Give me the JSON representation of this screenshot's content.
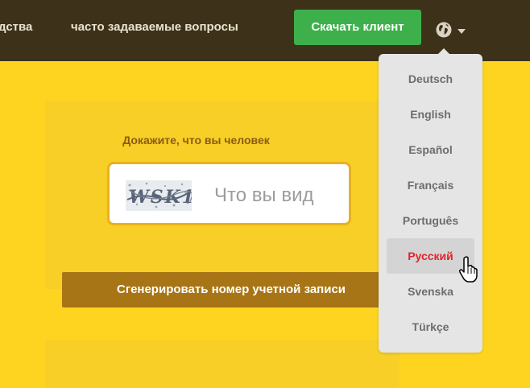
{
  "nav": {
    "links": [
      {
        "label": "дства"
      },
      {
        "label": "часто задаваемые вопросы"
      }
    ],
    "download_label": "Скачать клиент",
    "language_icon": "globe-icon"
  },
  "captcha": {
    "title": "Докажите, что вы человек",
    "image_text": "WSK1",
    "placeholder": "Что вы вид"
  },
  "generate_label": "Сгенерировать номер учетной записи",
  "language_menu": {
    "items": [
      {
        "label": "Deutsch"
      },
      {
        "label": "English"
      },
      {
        "label": "Español"
      },
      {
        "label": "Français"
      },
      {
        "label": "Português"
      },
      {
        "label": "Русский"
      },
      {
        "label": "Svenska"
      },
      {
        "label": "Türkçe"
      }
    ],
    "selected": "Русский"
  },
  "colors": {
    "page_background": "#fed421",
    "topbar": "#3d3219",
    "download_button": "#3db04b",
    "generate_button": "#a87516",
    "selected_language": "#e2232b"
  }
}
